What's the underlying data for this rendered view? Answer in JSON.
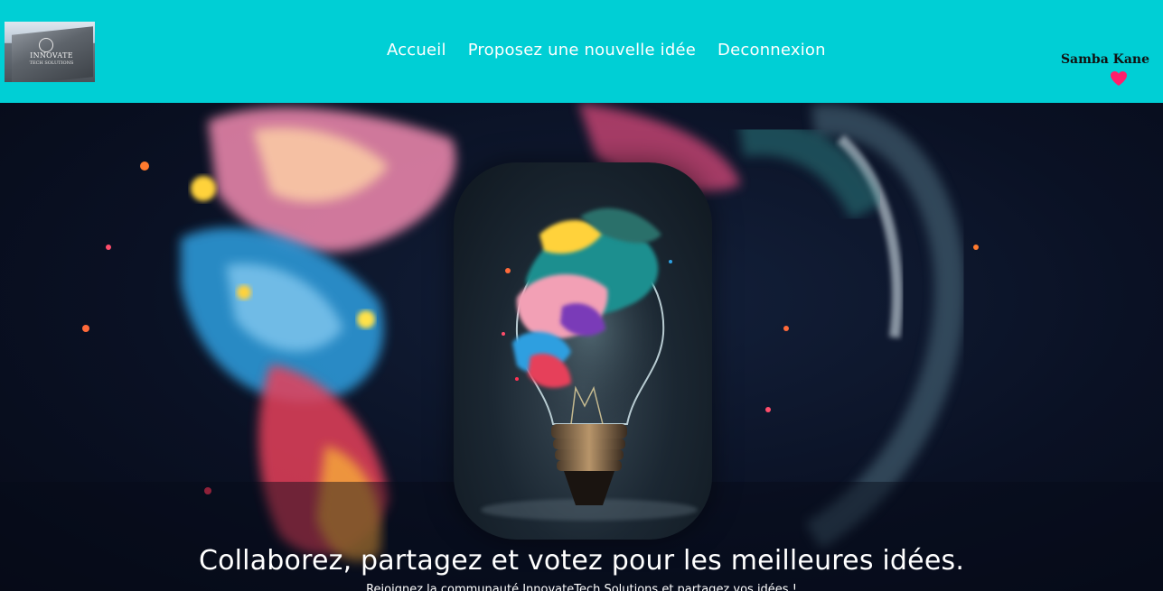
{
  "header": {
    "logo": {
      "brand_line1": "INNOVATE",
      "brand_line2": "TECH SOLUTIONS"
    },
    "nav": [
      {
        "label": "Accueil"
      },
      {
        "label": "Proposez une nouvelle idée"
      },
      {
        "label": "Deconnexion"
      }
    ],
    "user": {
      "name": "Samba Kane",
      "icon": "heart-icon"
    }
  },
  "hero": {
    "headline": "Collaborez, partagez et votez pour les meilleures idées.",
    "subline": "Rejoignez la communauté InnovateTech Solutions et partagez vos idées !"
  },
  "colors": {
    "navbar_bg": "#00cfd5",
    "nav_text": "#ffffff",
    "user_name": "#111111",
    "heart": "#ff1f6b"
  }
}
